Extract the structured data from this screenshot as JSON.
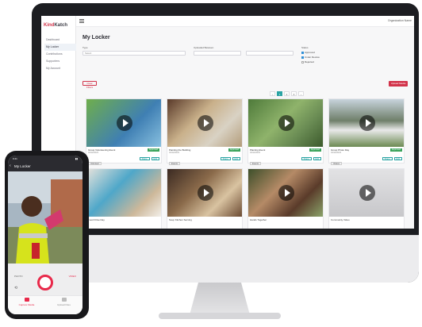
{
  "app": {
    "logo_kind": "Kind",
    "logo_katch": "Katch",
    "org_label": "Organization Name",
    "page_title": "My Locker"
  },
  "sidebar": {
    "items": [
      {
        "label": "Dashboard"
      },
      {
        "label": "My Locker"
      },
      {
        "label": "Contributions"
      },
      {
        "label": "Supporters"
      },
      {
        "label": "My Account"
      }
    ]
  },
  "filters": {
    "type_label": "Type",
    "type_value": "Select",
    "date_label": "Uploaded Between",
    "status_label": "Status",
    "status_options": [
      {
        "label": "Approved",
        "checked": true
      },
      {
        "label": "Under Review",
        "checked": true
      },
      {
        "label": "Rejected",
        "checked": false
      }
    ],
    "clear_label": "Clear Filters",
    "upload_label": "Upload Media"
  },
  "pagination": {
    "items": [
      "‹",
      "1",
      "2",
      "3",
      "›"
    ],
    "current": "1"
  },
  "cards": [
    {
      "title": "Group Volunteering Event",
      "date": "04/12/2023",
      "status": "Approved",
      "tag": "Volunteer",
      "actions": [
        "Share",
        "Edit"
      ]
    },
    {
      "title": "Painting the Building",
      "date": "04/12/2023",
      "status": "Approved",
      "tag": "Events",
      "actions": [
        "Share",
        "Edit"
      ]
    },
    {
      "title": "Planting Event",
      "date": "04/12/2023",
      "status": "Approved",
      "tag": "Events",
      "actions": [
        "Share",
        "Edit"
      ]
    },
    {
      "title": "Group Photo Day",
      "date": "04/12/2023",
      "status": "Approved",
      "tag": "Videos",
      "actions": [
        "Share",
        "Edit"
      ]
    },
    {
      "title": "Food Drive Day",
      "date": "",
      "status": "",
      "tag": "",
      "actions": []
    },
    {
      "title": "Soup Kitchen Serving",
      "date": "",
      "status": "",
      "tag": "",
      "actions": []
    },
    {
      "title": "Hands Together",
      "date": "",
      "status": "",
      "tag": "",
      "actions": []
    },
    {
      "title": "Community Video",
      "date": "",
      "status": "",
      "tag": "",
      "actions": []
    }
  ],
  "phone": {
    "time": "9:41",
    "title": "My Locker",
    "left_label": "PHOTO",
    "right_label": "VIDEO",
    "tabs": [
      {
        "label": "Capture Media",
        "active": true
      },
      {
        "label": "Upload Files",
        "active": false
      }
    ]
  },
  "colors": {
    "brand": "#d2334a",
    "accent": "#29a3a3",
    "approved": "#3aa35b"
  }
}
